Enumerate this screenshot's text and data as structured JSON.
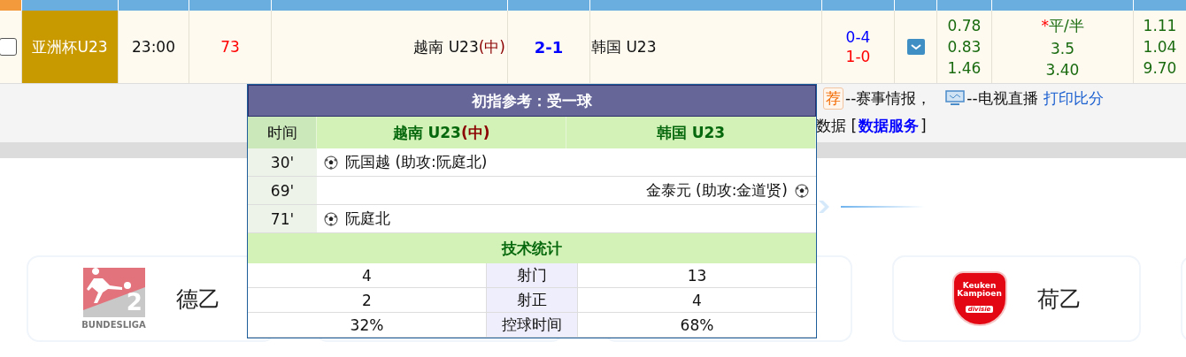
{
  "match": {
    "checked": false,
    "league": "亚洲杯U23",
    "time": "23:00",
    "minute": "73",
    "home": "越南 U23",
    "home_note": "(中)",
    "score": "2-1",
    "away": "韩国 U23",
    "extra_scores": [
      {
        "kind": "corners",
        "text": "0-4"
      },
      {
        "kind": "halftime",
        "text": "1-0"
      }
    ],
    "odds": [
      {
        "home": "0.78",
        "line_mark": "*",
        "line": "平/半",
        "away": "1.11"
      },
      {
        "home": "0.83",
        "line": "3.5",
        "away": "1.04"
      },
      {
        "home": "1.46",
        "line": "3.40",
        "away": "9.70"
      }
    ]
  },
  "legend": {
    "badge": "荐",
    "badge_text": "--赛事情报，",
    "tv_text": "--电视直播",
    "print_link": "打印比分",
    "data_prefix": "数据 [",
    "data_link": "数据服务",
    "data_suffix": "]"
  },
  "cards": [
    {
      "kind": "bundesliga",
      "name": "德乙",
      "logo_number": "2",
      "logo_text": [
        "BUNDESLIGA"
      ]
    },
    {
      "kind": "covered"
    },
    {
      "kind": "covered"
    },
    {
      "kind": "keuken",
      "name": "荷乙",
      "logo_text": [
        "Keuken",
        "Kampioen",
        "divisie"
      ]
    },
    {
      "kind": "covered"
    }
  ],
  "popup": {
    "title": "初指参考：受一球",
    "time_header": "时间",
    "home_team": "越南 U23",
    "home_note": "(中)",
    "away_team": "韩国 U23",
    "events": [
      {
        "time": "30'",
        "kind": "home",
        "text": "阮国越 (助攻:阮庭北)"
      },
      {
        "time": "69'",
        "kind": "away",
        "text": "金泰元 (助攻:金道贤)"
      },
      {
        "time": "71'",
        "kind": "home",
        "text": "阮庭北"
      }
    ],
    "stats_title": "技术统计",
    "stats": [
      {
        "home": "4",
        "label": "射门",
        "away": "13"
      },
      {
        "home": "2",
        "label": "射正",
        "away": "4"
      },
      {
        "home": "32%",
        "label": "控球时间",
        "away": "68%"
      }
    ]
  }
}
